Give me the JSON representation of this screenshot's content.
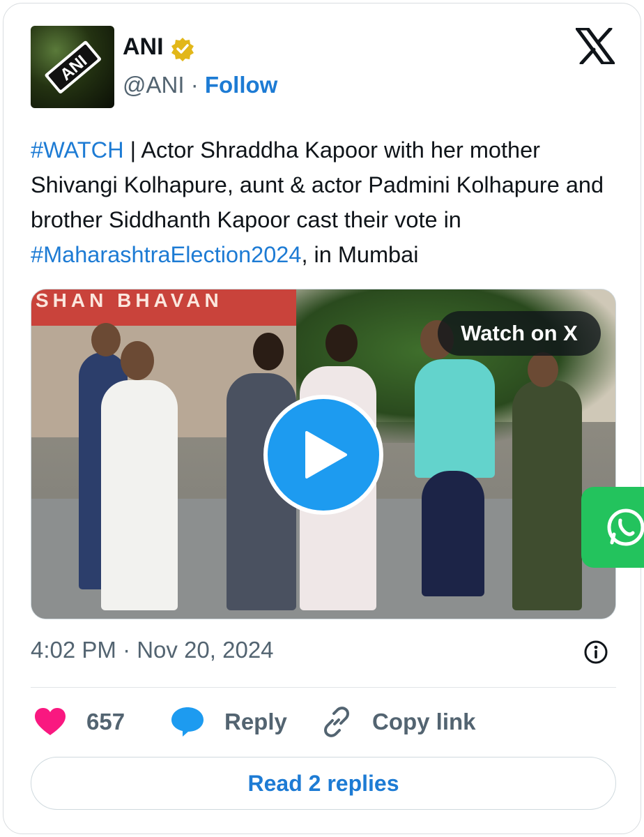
{
  "author": {
    "name": "ANI",
    "handle": "@ANI",
    "separator": "·",
    "follow_label": "Follow",
    "avatar_text": "ANI"
  },
  "tweet": {
    "hashtag_watch": "#WATCH",
    "text_part1": " | Actor Shraddha Kapoor with her mother Shivangi Kolhapure, aunt & actor Padmini Kolhapure and brother Siddhanth Kapoor cast their vote in ",
    "hashtag_election": "#MaharashtraElection2024",
    "text_part2": ", in Mumbai"
  },
  "media": {
    "banner_text": "SHAN BHAVAN",
    "watch_label": "Watch on X"
  },
  "meta": {
    "timestamp": "4:02 PM · Nov 20, 2024"
  },
  "actions": {
    "like_count": "657",
    "reply_label": "Reply",
    "copy_label": "Copy link"
  },
  "read_replies_label": "Read 2 replies",
  "colors": {
    "accent": "#1d7bd4",
    "like": "#f91880",
    "play": "#1d9bf0",
    "whatsapp": "#23c35d"
  }
}
